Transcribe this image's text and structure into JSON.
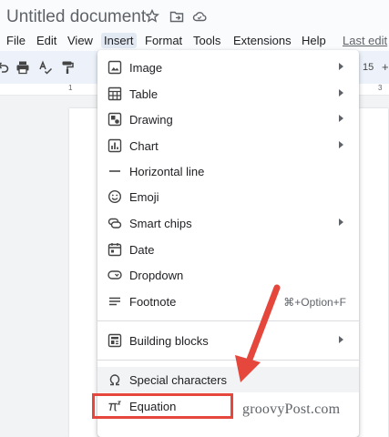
{
  "document": {
    "title": "Untitled document"
  },
  "title_icons": [
    "star-icon",
    "move-to-folder-icon",
    "cloud-status-icon"
  ],
  "menubar": {
    "items": [
      "File",
      "Edit",
      "View",
      "Insert",
      "Format",
      "Tools",
      "Extensions",
      "Help"
    ],
    "active": "Insert",
    "last_edit": "Last edit"
  },
  "toolbar": {
    "icons": [
      "undo-icon",
      "print-icon",
      "spellcheck-icon",
      "paint-format-icon"
    ],
    "font_size": "15",
    "font_size_increase": "+"
  },
  "ruler": {
    "labels": [
      "1",
      "3"
    ]
  },
  "insert_menu": {
    "items": [
      {
        "label": "Image",
        "icon": "image-icon",
        "submenu": true
      },
      {
        "label": "Table",
        "icon": "table-icon",
        "submenu": true
      },
      {
        "label": "Drawing",
        "icon": "drawing-icon",
        "submenu": true
      },
      {
        "label": "Chart",
        "icon": "chart-icon",
        "submenu": true
      },
      {
        "label": "Horizontal line",
        "icon": "horizontal-line-icon",
        "submenu": false
      },
      {
        "label": "Emoji",
        "icon": "emoji-icon",
        "submenu": false
      },
      {
        "label": "Smart chips",
        "icon": "smart-chips-icon",
        "submenu": true
      },
      {
        "label": "Date",
        "icon": "calendar-icon",
        "submenu": false
      },
      {
        "label": "Dropdown",
        "icon": "dropdown-icon",
        "submenu": false
      },
      {
        "label": "Footnote",
        "icon": "footnote-icon",
        "submenu": false,
        "shortcut": "⌘+Option+F"
      },
      {
        "label": "Building blocks",
        "icon": "building-blocks-icon",
        "submenu": true
      },
      {
        "label": "Special characters",
        "icon": "omega-icon",
        "submenu": false
      },
      {
        "label": "Equation",
        "icon": "pi-icon",
        "submenu": false
      }
    ],
    "highlighted": "Equation"
  },
  "annotation": {
    "color": "#e5473c"
  },
  "watermark": "groovyPost.com"
}
